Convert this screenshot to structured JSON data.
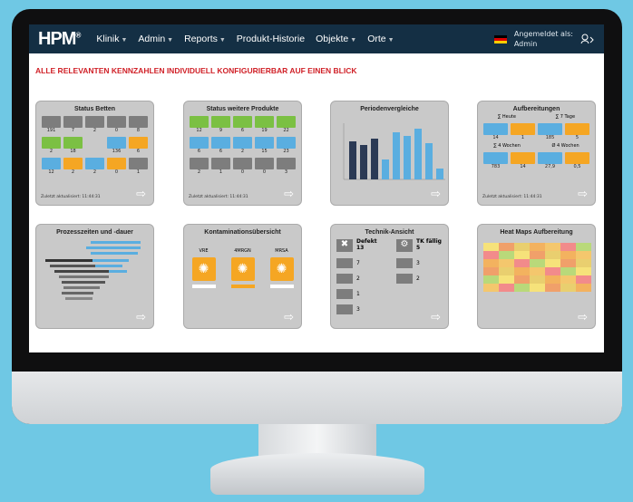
{
  "nav": {
    "logo": "HPM",
    "logo_mark": "®",
    "items": [
      "Klinik",
      "Admin",
      "Reports",
      "Produkt-Historie",
      "Objekte",
      "Orte"
    ],
    "login_label": "Angemeldet als:",
    "user": "Admin"
  },
  "headline": "ALLE RELEVANTEN KENNZAHLEN INDIVIDUELL KONFIGURIERBAR AUF EINEN BLICK",
  "cards": {
    "betten": {
      "title": "Status Betten",
      "values": [
        "191",
        "7",
        "2",
        "0",
        "8",
        "2",
        "18",
        "",
        "136",
        "6",
        "12",
        "2",
        "2",
        "0",
        "1"
      ],
      "updated": "Zuletzt aktualisiert: 11:44:31"
    },
    "produkte": {
      "title": "Status weitere Produkte",
      "values": [
        "12",
        "9",
        "6",
        "19",
        "22",
        "6",
        "6",
        "2",
        "15",
        "23",
        "2",
        "1",
        "0",
        "0",
        "3"
      ],
      "updated": "Zuletzt aktualisiert: 11:44:31"
    },
    "perioden": {
      "title": "Periodenvergleiche"
    },
    "aufbereitung": {
      "title": "Aufbereitungen",
      "label_heute": "∑ Heute",
      "label_7tage": "∑ 7 Tage",
      "values_top": [
        "14",
        "1",
        "185",
        "5"
      ],
      "label_4wochen": "∑ 4 Wochen",
      "label_avg": "Ø 4 Wochen",
      "values_bottom": [
        "783",
        "14",
        "27,9",
        "0,5"
      ],
      "updated": "Zuletzt aktualisiert: 11:44:31"
    },
    "prozess": {
      "title": "Prozesszeiten und -dauer"
    },
    "kontamination": {
      "title": "Kontaminationsübersicht",
      "labels": [
        "VRE",
        "4MRGN",
        "MRSA"
      ]
    },
    "technik": {
      "title": "Technik-Ansicht",
      "defekt_label": "Defekt",
      "defekt_value": "13",
      "tk_label": "TK fällig",
      "tk_value": "5",
      "values": [
        "7",
        "3",
        "2",
        "2",
        "1",
        "3"
      ]
    },
    "heatmap": {
      "title": "Heat Maps Aufbereitung"
    }
  },
  "colors": {
    "nav": "#142f44",
    "headline": "#d02027",
    "green": "#7bc043",
    "blue": "#5aaee0",
    "orange": "#f5a623",
    "grey": "#7d7d7d",
    "darkbar": "#2b3a55"
  }
}
